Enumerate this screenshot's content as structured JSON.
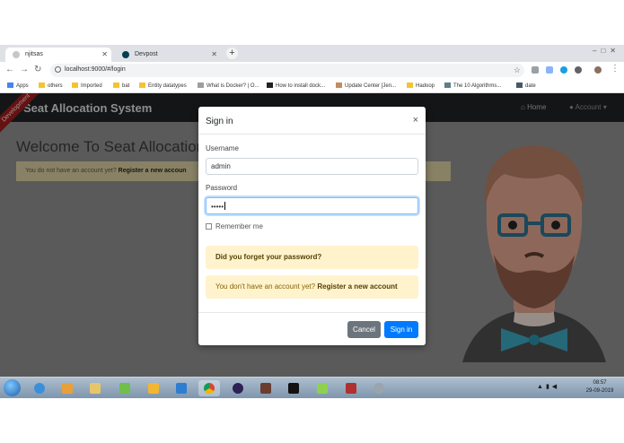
{
  "browser": {
    "tabs": [
      {
        "title": "njitsas",
        "active": true
      },
      {
        "title": "Devpost",
        "active": false
      }
    ],
    "new_tab_label": "+",
    "url": "localhost:9000/#/login",
    "bookmarks": [
      {
        "label": "Apps",
        "icon": "apps-grid-icon"
      },
      {
        "label": "others",
        "icon": "folder-icon"
      },
      {
        "label": "Imported",
        "icon": "folder-icon"
      },
      {
        "label": "bat",
        "icon": "folder-icon"
      },
      {
        "label": "Entity datatypes",
        "icon": "folder-icon"
      },
      {
        "label": "What is Docker? | O...",
        "icon": "page-icon"
      },
      {
        "label": "How to install dock...",
        "icon": "page-icon"
      },
      {
        "label": "Update Center [Jen...",
        "icon": "jenkins-icon"
      },
      {
        "label": "Hadoop",
        "icon": "folder-icon"
      },
      {
        "label": "The 10 Algorithms...",
        "icon": "page-icon"
      },
      {
        "label": "date",
        "icon": "page-icon"
      }
    ]
  },
  "app": {
    "ribbon": "Development",
    "brand": "Seat Allocation System",
    "nav": {
      "home": "Home",
      "account": "Account"
    },
    "welcome": "Welcome To Seat Allocation S",
    "warning_text": "You do not have an account yet?",
    "warning_link": "Register a new accoun"
  },
  "modal": {
    "title": "Sign in",
    "close": "×",
    "username_label": "Username",
    "username_value": "admin",
    "password_label": "Password",
    "password_value": "•••••",
    "remember_label": "Remember me",
    "forgot_text": "Did you forget your password?",
    "register_text": "You don't have an account yet?",
    "register_link": "Register a new account",
    "cancel_label": "Cancel",
    "signin_label": "Sign in"
  },
  "taskbar": {
    "time": "08:57",
    "date": "29-09-2019"
  },
  "colors": {
    "primary": "#007bff",
    "secondary": "#6c757d",
    "warning_bg": "#fff3cd",
    "navbar": "#1f2124",
    "ribbon": "#9b1c1c"
  }
}
